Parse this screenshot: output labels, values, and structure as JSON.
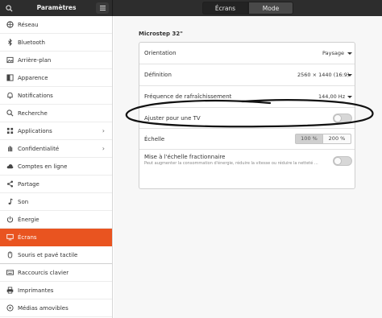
{
  "header": {
    "app_title": "Paramètres",
    "tabs": [
      {
        "label": "Écrans"
      },
      {
        "label": "Mode nuit"
      }
    ]
  },
  "sidebar": {
    "items": [
      {
        "label": "Réseau",
        "icon": "network-icon"
      },
      {
        "label": "Bluetooth",
        "icon": "bluetooth-icon"
      },
      {
        "label": "Arrière-plan",
        "icon": "background-icon"
      },
      {
        "label": "Apparence",
        "icon": "appearance-icon"
      },
      {
        "label": "Notifications",
        "icon": "bell-icon"
      },
      {
        "label": "Recherche",
        "icon": "search-icon"
      },
      {
        "label": "Applications",
        "icon": "apps-grid-icon",
        "chevron": "›"
      },
      {
        "label": "Confidentialité",
        "icon": "hand-icon",
        "chevron": "›"
      },
      {
        "label": "Comptes en ligne",
        "icon": "cloud-icon"
      },
      {
        "label": "Partage",
        "icon": "share-icon"
      },
      {
        "label": "Son",
        "icon": "music-note-icon"
      },
      {
        "label": "Énergie",
        "icon": "power-icon"
      },
      {
        "label": "Écrans",
        "icon": "display-icon",
        "active": true
      },
      {
        "label": "Souris et pavé tactile",
        "icon": "mouse-icon"
      },
      {
        "label": "Raccourcis clavier",
        "icon": "keyboard-icon"
      },
      {
        "label": "Imprimantes",
        "icon": "printer-icon"
      },
      {
        "label": "Médias amovibles",
        "icon": "media-icon"
      }
    ]
  },
  "main": {
    "monitor_name": "Microstep 32\"",
    "orientation": {
      "label": "Orientation",
      "value": "Paysage"
    },
    "definition": {
      "label": "Définition",
      "value": "2560 × 1440 (16:9)"
    },
    "refresh": {
      "label": "Fréquence de rafraîchissement",
      "value": "144,00 Hz"
    },
    "tv": {
      "label": "Ajuster pour une TV",
      "enabled": false
    },
    "scale": {
      "label": "Échelle",
      "options": [
        "100 %",
        "200 %"
      ],
      "selected": "100 %"
    },
    "fractional": {
      "label": "Mise à l'échelle fractionnaire",
      "description": "Peut augmenter la consommation d'énergie, réduire la vitesse ou réduire la netteté ...",
      "enabled": false
    }
  },
  "colors": {
    "accent": "#e95420",
    "header": "#2d2d2d",
    "annotation": "#111111"
  }
}
